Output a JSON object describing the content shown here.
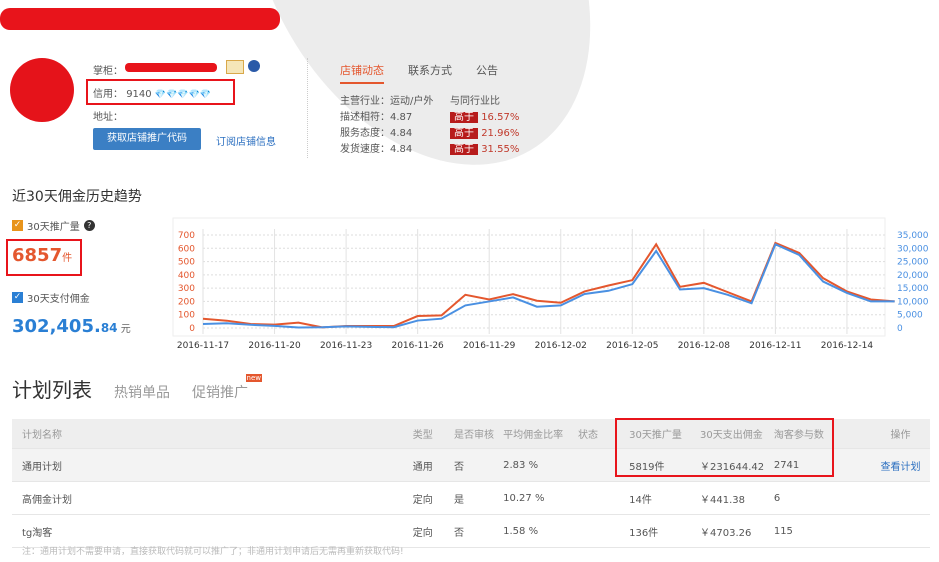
{
  "shop": {
    "owner_label": "掌柜：",
    "credit_label": "信用：",
    "credit_value": "9140",
    "diamonds": "💎💎💎💎💎",
    "address_label": "地址：",
    "get_code_button": "获取店铺推广代码",
    "subscribe_link": "订阅店铺信息"
  },
  "tabs": [
    "店铺动态",
    "联系方式",
    "公告"
  ],
  "dynamics": {
    "industry_label": "主营行业：运动/户外",
    "compare_label": "与同行业比",
    "rows": [
      {
        "label": "描述相符：4.87",
        "badge": "高于",
        "pct": "16.57%"
      },
      {
        "label": "服务态度：4.84",
        "badge": "高于",
        "pct": "21.96%"
      },
      {
        "label": "发货速度：4.84",
        "badge": "高于",
        "pct": "31.55%"
      }
    ]
  },
  "trend": {
    "title": "近30天佣金历史趋势",
    "promo_label": "30天推广量",
    "promo_value": "6857",
    "promo_unit": "件",
    "paid_label": "30天支付佣金",
    "paid_value": "302,405.",
    "paid_decimal": "84",
    "paid_unit": "元"
  },
  "chart_data": {
    "type": "line",
    "x": [
      "2016-11-17",
      "2016-11-18",
      "2016-11-19",
      "2016-11-20",
      "2016-11-21",
      "2016-11-22",
      "2016-11-23",
      "2016-11-24",
      "2016-11-25",
      "2016-11-26",
      "2016-11-27",
      "2016-11-28",
      "2016-11-29",
      "2016-11-30",
      "2016-12-01",
      "2016-12-02",
      "2016-12-03",
      "2016-12-04",
      "2016-12-05",
      "2016-12-06",
      "2016-12-07",
      "2016-12-08",
      "2016-12-09",
      "2016-12-10",
      "2016-12-11",
      "2016-12-12",
      "2016-12-13",
      "2016-12-14",
      "2016-12-15",
      "2016-12-16"
    ],
    "xticks": [
      "2016-11-17",
      "2016-11-20",
      "2016-11-23",
      "2016-11-26",
      "2016-11-29",
      "2016-12-02",
      "2016-12-05",
      "2016-12-08",
      "2016-12-11",
      "2016-12-14"
    ],
    "series": [
      {
        "name": "30天推广量",
        "axis": "left",
        "color": "#e4572e",
        "values": [
          70,
          55,
          30,
          25,
          40,
          5,
          15,
          15,
          15,
          90,
          95,
          250,
          215,
          255,
          205,
          190,
          275,
          320,
          360,
          630,
          310,
          340,
          270,
          200,
          640,
          565,
          375,
          275,
          215,
          200
        ]
      },
      {
        "name": "30天支付佣金",
        "axis": "right",
        "color": "#4a90e2",
        "values": [
          1500,
          1800,
          1200,
          800,
          200,
          300,
          600,
          400,
          300,
          2800,
          3500,
          8500,
          10000,
          11500,
          8000,
          8500,
          12800,
          14000,
          16500,
          29000,
          14500,
          15000,
          12500,
          9300,
          31500,
          27500,
          17500,
          13200,
          10000,
          10000
        ]
      }
    ],
    "ylim_left": [
      0,
      700
    ],
    "yticks_left": [
      "0",
      "100",
      "200",
      "300",
      "400",
      "500",
      "600",
      "700"
    ],
    "ylim_right": [
      0,
      35000
    ],
    "yticks_right": [
      "0",
      "5,000",
      "10,000",
      "15,000",
      "20,000",
      "25,000",
      "30,000",
      "35,000"
    ],
    "grid": true
  },
  "plans": {
    "tabs": [
      "计划列表",
      "热销单品",
      "促销推广"
    ],
    "new_badge": "new",
    "headers": [
      "计划名称",
      "类型",
      "是否审核",
      "平均佣金比率",
      "状态",
      "30天推广量",
      "30天支出佣金",
      "淘客参与数",
      "操作"
    ],
    "rows": [
      [
        "通用计划",
        "通用",
        "否",
        "2.83 %",
        "",
        "5819件",
        "￥231644.42",
        "2741",
        "查看计划"
      ],
      [
        "高佣金计划",
        "定向",
        "是",
        "10.27 %",
        "",
        "14件",
        "￥441.38",
        "6",
        ""
      ],
      [
        "tg淘客",
        "定向",
        "否",
        "1.58 %",
        "",
        "136件",
        "￥4703.26",
        "115",
        ""
      ]
    ],
    "note": "注：通用计划不需要申请，直接获取代码就可以推广了；非通用计划申请后无需再重新获取代码!"
  }
}
